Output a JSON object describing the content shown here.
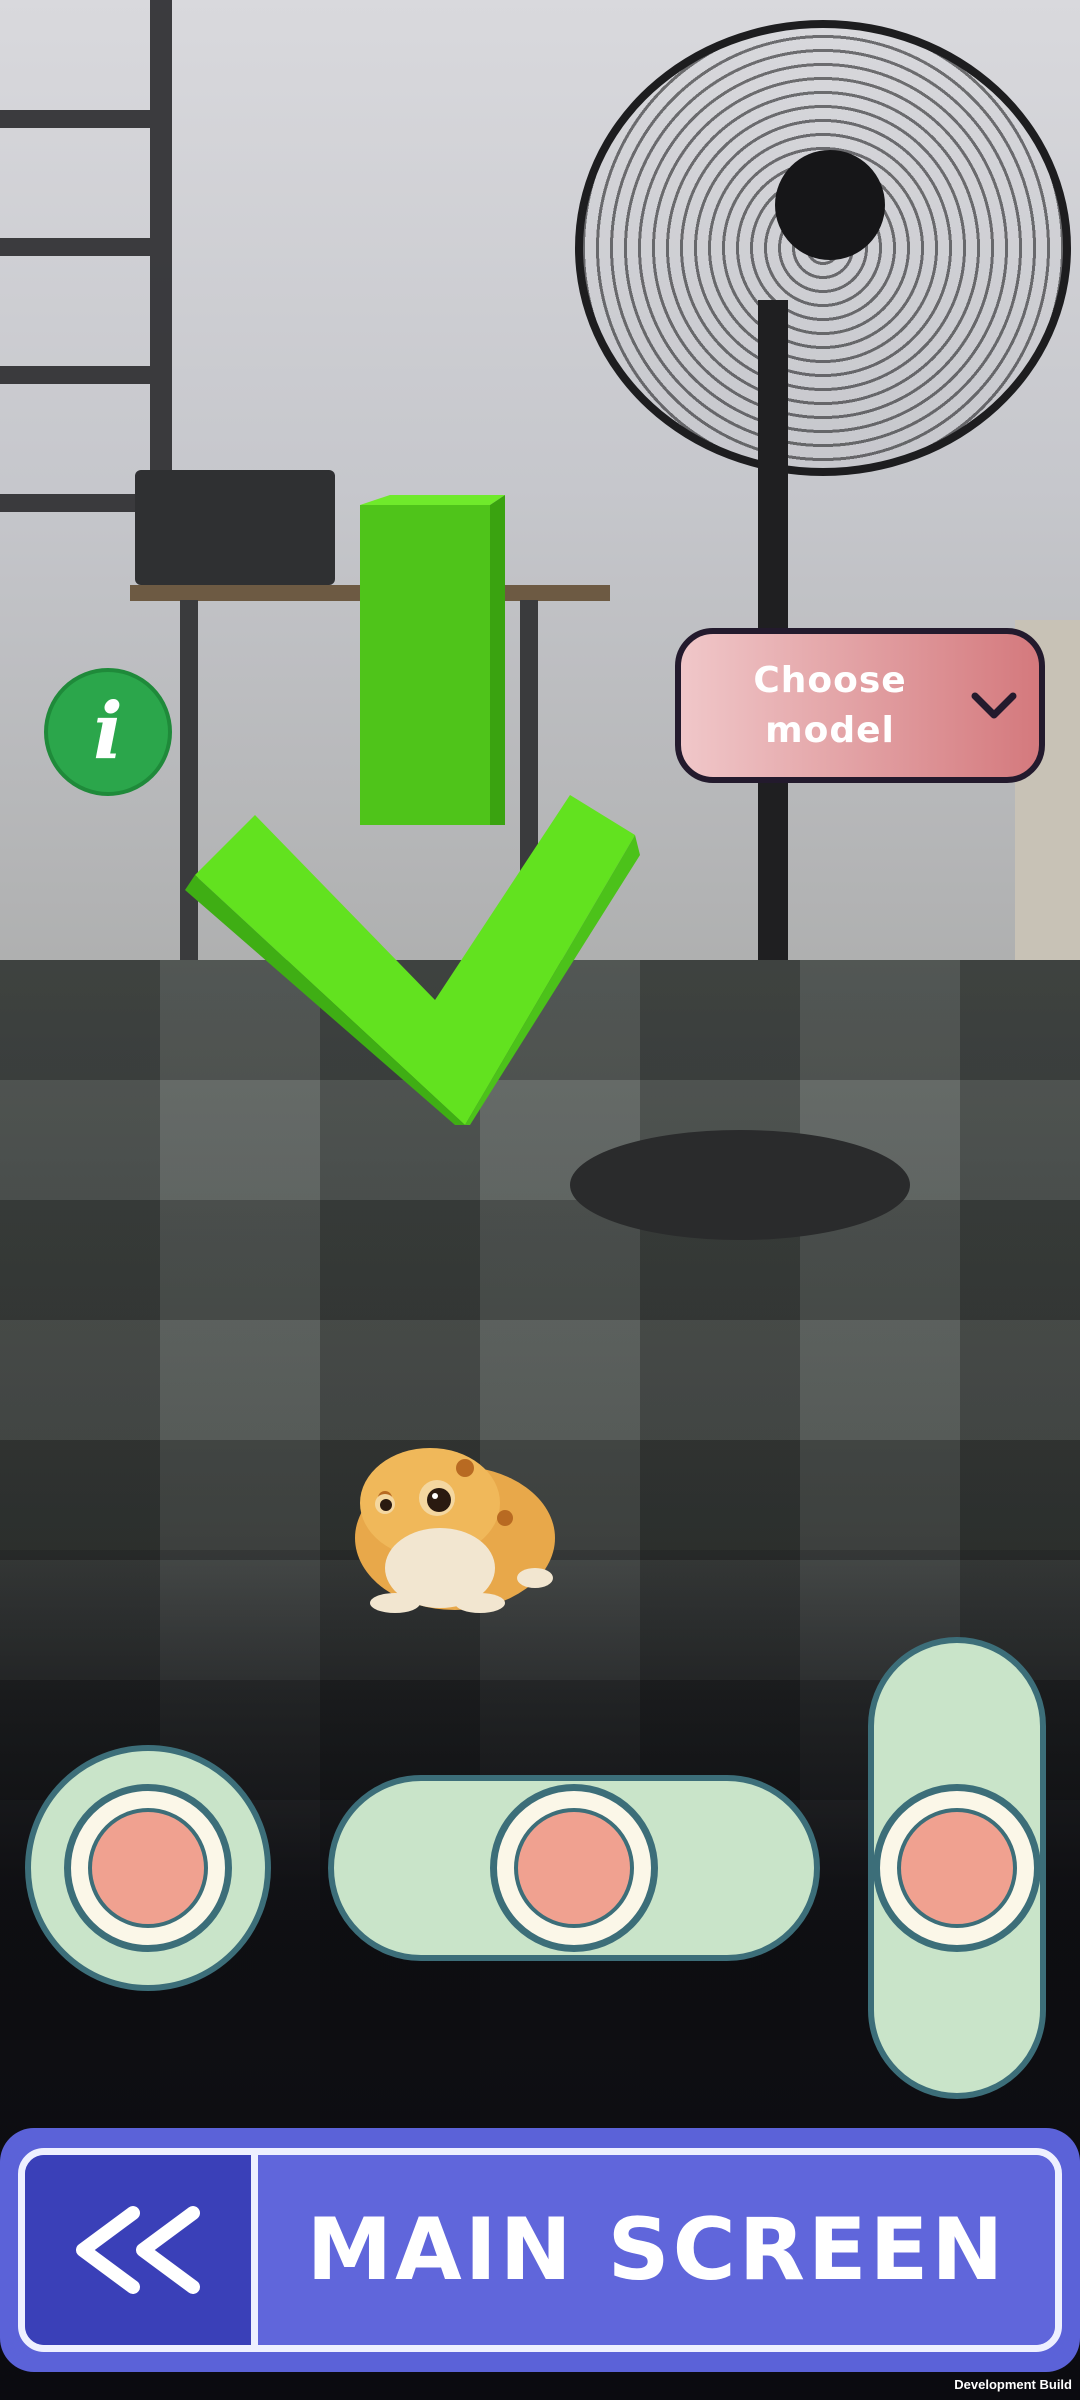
{
  "info_button": {
    "glyph": "i",
    "color": "#2ba64b"
  },
  "model_dropdown": {
    "label": "Choose\nmodel",
    "icon": "chevron-down-icon"
  },
  "joysticks": {
    "round": {
      "name": "round-joystick"
    },
    "horizontal": {
      "name": "horizontal-slider-joystick"
    },
    "vertical": {
      "name": "vertical-slider-joystick"
    }
  },
  "bottom_bar": {
    "back_icon": "double-chevron-left-icon",
    "main_label": "MAIN SCREEN"
  },
  "footer": {
    "build_label": "Development Build"
  },
  "colors": {
    "accent_blue": "#5b62d8",
    "pad_green": "#c9e4c9",
    "pad_border": "#3c6e79",
    "knob_fill": "#f0a190",
    "arrow_green": "#62e21f"
  }
}
